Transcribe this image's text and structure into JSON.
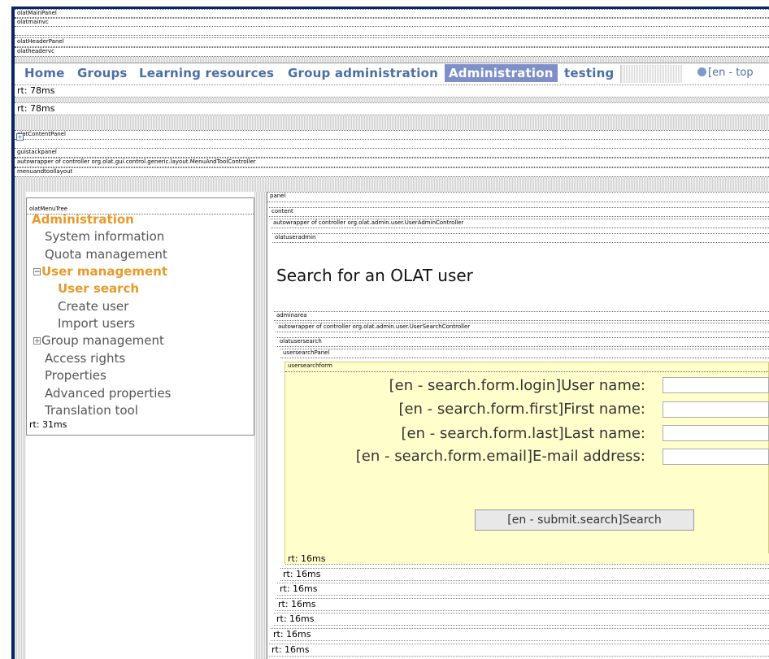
{
  "debug": {
    "main_panel": "olatMainPanel",
    "main_vc": "olatmainvc",
    "header_panel": "olatHeaderPanel",
    "header_vc": "olatheadervc",
    "content_panel": "olatContentPanel",
    "stack_panel": "guistackpanel",
    "autowrapper_menu": "autowrapper of controller org.olat.gui.control.generic.layout.MenuAndToolController",
    "menu_layout": "menuandtoollayout",
    "menu_tree": "olatMenuTree",
    "panel": "panel",
    "content": "content",
    "autowrapper_useradmin": "autowrapper of controller org.olat.admin.user.UserAdminController",
    "useradmin": "olatuseradmin",
    "adminarea": "adminarea",
    "autowrapper_search": "autowrapper of controller org.olat.admin.user.UserSearchController",
    "usersearch": "olatusersearch",
    "usersearch_panel": "usersearchPanel",
    "usersearch_form": "usersearchform"
  },
  "nav": {
    "items": [
      "Home",
      "Groups",
      "Learning resources",
      "Group administration",
      "Administration",
      "testing"
    ],
    "active": "Administration",
    "lang": "[en - top"
  },
  "timings": {
    "rt78": "rt: 78ms",
    "rt31": "rt: 31ms",
    "rt16": "rt: 16ms"
  },
  "menu": {
    "items": [
      {
        "label": "Administration",
        "level": 0,
        "highlight": true
      },
      {
        "label": "System information",
        "level": 1
      },
      {
        "label": "Quota management",
        "level": 1
      },
      {
        "label": "User management",
        "level": 0,
        "highlight": true,
        "icon": "minus"
      },
      {
        "label": "User search",
        "level": 2,
        "highlight": true
      },
      {
        "label": "Create user",
        "level": 2
      },
      {
        "label": "Import users",
        "level": 2
      },
      {
        "label": "Group management",
        "level": 1,
        "icon": "plus"
      },
      {
        "label": "Access rights",
        "level": 1
      },
      {
        "label": "Properties",
        "level": 1
      },
      {
        "label": "Advanced properties",
        "level": 1
      },
      {
        "label": "Translation tool",
        "level": 1
      }
    ]
  },
  "main": {
    "title": "Search for an OLAT user"
  },
  "form": {
    "login_label": "[en - search.form.login]User name:",
    "first_label": "[en - search.form.first]First name:",
    "last_label": "[en - search.form.last]Last name:",
    "email_label": "[en - search.form.email]E-mail address:",
    "login_value": "",
    "first_value": "",
    "last_value": "",
    "email_value": "",
    "submit_label": "[en - submit.search]Search"
  },
  "colors": {
    "nav_text": "#4a6fa5",
    "nav_active_bg": "#7f8fc9",
    "menu_highlight": "#e89a2a",
    "form_bg": "#ffffcc"
  }
}
